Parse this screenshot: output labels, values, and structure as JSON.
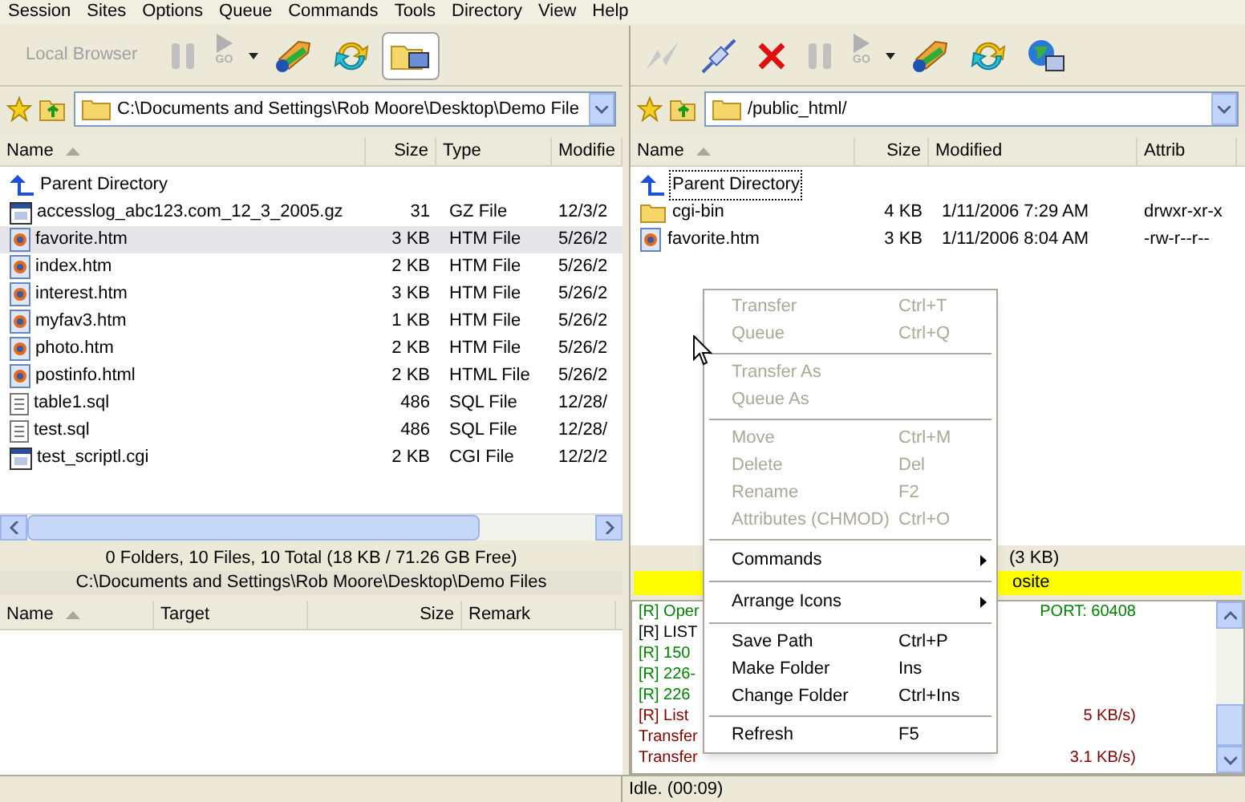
{
  "menu_bar": [
    "Session",
    "Sites",
    "Options",
    "Queue",
    "Commands",
    "Tools",
    "Directory",
    "View",
    "Help"
  ],
  "local": {
    "toolbar": [
      {
        "kind": "text",
        "label": "Local Browser",
        "disabled": true
      },
      {
        "kind": "pause",
        "disabled": true
      },
      {
        "kind": "go",
        "label": "GO",
        "disabled": true
      },
      {
        "kind": "caret"
      },
      {
        "kind": "sync"
      },
      {
        "kind": "refresh"
      },
      {
        "kind": "folder-pc",
        "pressed": true
      }
    ],
    "path": "C:\\Documents and Settings\\Rob Moore\\Desktop\\Demo File",
    "columns": [
      "Name",
      "Size",
      "Type",
      "Modifie"
    ],
    "rows": [
      {
        "kind": "up",
        "name": "Parent Directory",
        "size": "",
        "type": "",
        "modified": "",
        "selected": false
      },
      {
        "kind": "archive",
        "name": "accesslog_abc123.com_12_3_2005.gz",
        "size": "31",
        "type": "GZ File",
        "modified": "12/3/2",
        "selected": false
      },
      {
        "kind": "web",
        "name": "favorite.htm",
        "size": "3 KB",
        "type": "HTM File",
        "modified": "5/26/2",
        "selected": true
      },
      {
        "kind": "web",
        "name": "index.htm",
        "size": "2 KB",
        "type": "HTM File",
        "modified": "5/26/2",
        "selected": false
      },
      {
        "kind": "web",
        "name": "interest.htm",
        "size": "3 KB",
        "type": "HTM File",
        "modified": "5/26/2",
        "selected": false
      },
      {
        "kind": "web",
        "name": "myfav3.htm",
        "size": "1 KB",
        "type": "HTM File",
        "modified": "5/26/2",
        "selected": false
      },
      {
        "kind": "web",
        "name": "photo.htm",
        "size": "2 KB",
        "type": "HTM File",
        "modified": "5/26/2",
        "selected": false
      },
      {
        "kind": "web",
        "name": "postinfo.html",
        "size": "2 KB",
        "type": "HTML File",
        "modified": "5/26/2",
        "selected": false
      },
      {
        "kind": "text",
        "name": "table1.sql",
        "size": "486",
        "type": "SQL File",
        "modified": "12/28/",
        "selected": false
      },
      {
        "kind": "text",
        "name": "test.sql",
        "size": "486",
        "type": "SQL File",
        "modified": "12/28/",
        "selected": false
      },
      {
        "kind": "archive",
        "name": "test_scriptl.cgi",
        "size": "2 KB",
        "type": "CGI File",
        "modified": "12/2/2",
        "selected": false
      }
    ],
    "summary": "0 Folders, 10 Files, 10 Total (18 KB / 71.26 GB Free)",
    "path_label": "C:\\Documents and Settings\\Rob Moore\\Desktop\\Demo Files"
  },
  "queue": {
    "columns": [
      "Name",
      "Target",
      "Size",
      "Remark"
    ]
  },
  "remote": {
    "toolbar": [
      {
        "kind": "connect",
        "disabled": true
      },
      {
        "kind": "plug"
      },
      {
        "kind": "stop"
      },
      {
        "kind": "pause",
        "disabled": true
      },
      {
        "kind": "go",
        "label": "GO",
        "disabled": true
      },
      {
        "kind": "caret"
      },
      {
        "kind": "sync"
      },
      {
        "kind": "refresh"
      },
      {
        "kind": "globe-pc"
      }
    ],
    "path": "/public_html/",
    "columns": [
      "Name",
      "Size",
      "Modified",
      "Attrib"
    ],
    "rows": [
      {
        "kind": "up",
        "name": "Parent Directory",
        "size": "",
        "modified": "",
        "attrib": "",
        "focused": true
      },
      {
        "kind": "folder",
        "name": "cgi-bin",
        "size": "4 KB",
        "modified": "1/11/2006 7:29 AM",
        "attrib": "drwxr-xr-x",
        "focused": false
      },
      {
        "kind": "web",
        "name": "favorite.htm",
        "size": "3 KB",
        "modified": "1/11/2006 8:04 AM",
        "attrib": "-rw-r--r--",
        "focused": false
      }
    ],
    "summary": "(3 KB)",
    "status_line": "osite",
    "log": [
      {
        "left": "[R] Oper",
        "right": "PORT: 60408",
        "color": "#008000"
      },
      {
        "left": "[R] LIST",
        "color": "#000000"
      },
      {
        "left": "[R] 150",
        "color": "#008000"
      },
      {
        "left": "[R] 226-",
        "color": "#008000"
      },
      {
        "left": "[R] 226",
        "color": "#008000"
      },
      {
        "left": "[R] List",
        "right": "5 KB/s)",
        "color": "#800000"
      },
      {
        "left": "Transfer",
        "color": "#800000"
      },
      {
        "left": "Transfer",
        "right": "3.1 KB/s)",
        "color": "#800000"
      }
    ],
    "status": "Idle. (00:09)"
  },
  "context_menu": [
    {
      "kind": "item",
      "label": "Transfer",
      "shortcut": "Ctrl+T",
      "disabled": true
    },
    {
      "kind": "item",
      "label": "Queue",
      "shortcut": "Ctrl+Q",
      "disabled": true
    },
    {
      "kind": "separator"
    },
    {
      "kind": "item",
      "label": "Transfer As",
      "disabled": true
    },
    {
      "kind": "item",
      "label": "Queue As",
      "disabled": true
    },
    {
      "kind": "separator"
    },
    {
      "kind": "item",
      "label": "Move",
      "shortcut": "Ctrl+M",
      "disabled": true
    },
    {
      "kind": "item",
      "label": "Delete",
      "shortcut": "Del",
      "disabled": true
    },
    {
      "kind": "item",
      "label": "Rename",
      "shortcut": "F2",
      "disabled": true
    },
    {
      "kind": "item",
      "label": "Attributes (CHMOD)",
      "shortcut": "Ctrl+O",
      "disabled": true
    },
    {
      "kind": "separator"
    },
    {
      "kind": "submenu",
      "label": "Commands",
      "disabled": false
    },
    {
      "kind": "separator"
    },
    {
      "kind": "submenu",
      "label": "Arrange Icons",
      "disabled": false
    },
    {
      "kind": "separator"
    },
    {
      "kind": "item",
      "label": "Save Path",
      "shortcut": "Ctrl+P",
      "disabled": false
    },
    {
      "kind": "item",
      "label": "Make Folder",
      "shortcut": "Ins",
      "disabled": false
    },
    {
      "kind": "item",
      "label": "Change Folder",
      "shortcut": "Ctrl+Ins",
      "disabled": false
    },
    {
      "kind": "separator"
    },
    {
      "kind": "item",
      "label": "Refresh",
      "shortcut": "F5",
      "disabled": false
    }
  ]
}
